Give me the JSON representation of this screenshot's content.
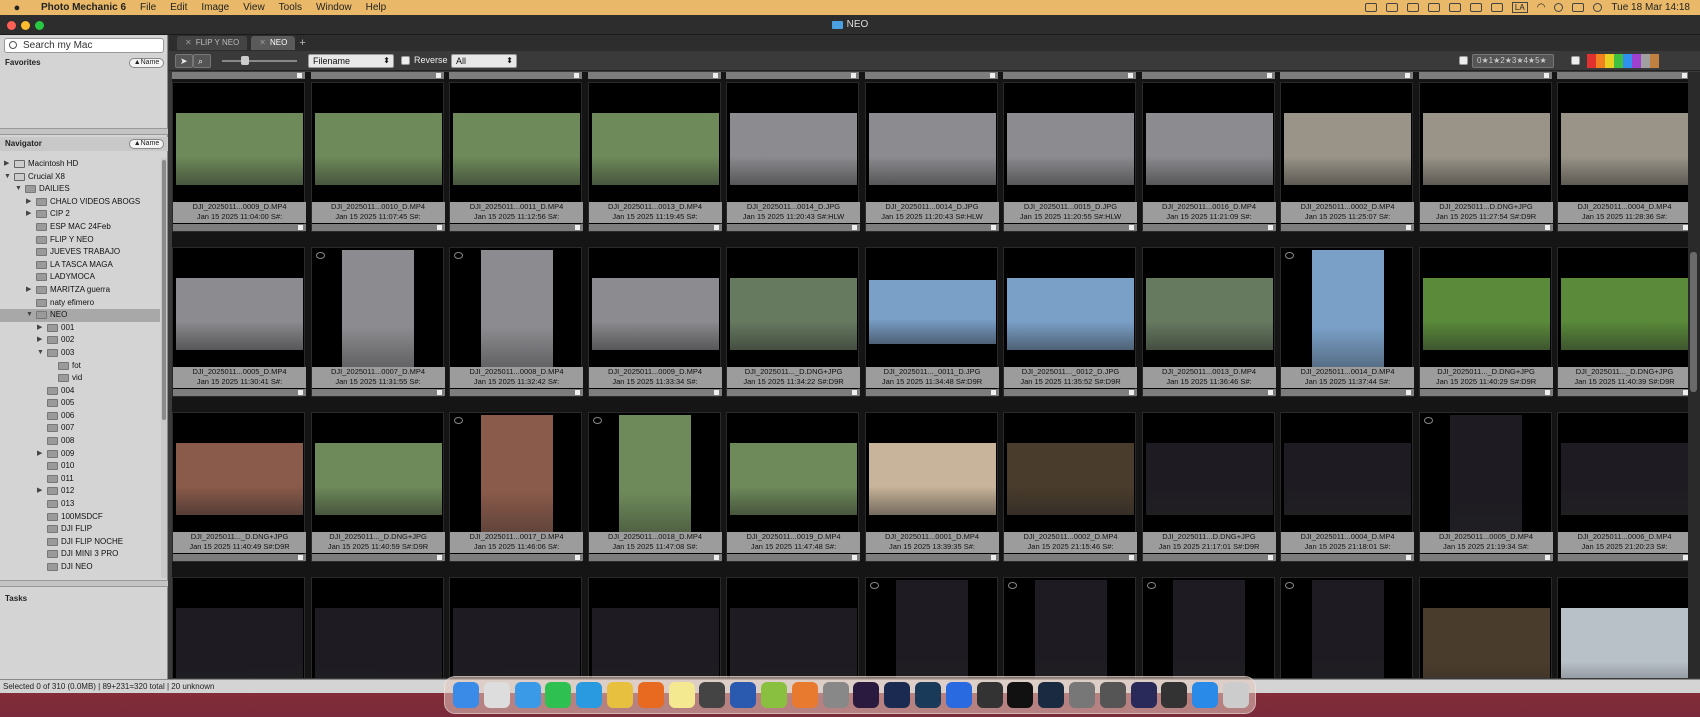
{
  "menubar": {
    "app_name": "Photo Mechanic 6",
    "items": [
      "File",
      "Edit",
      "Image",
      "View",
      "Tools",
      "Window",
      "Help"
    ],
    "clock": "Tue 18 Mar  14:18",
    "input_lang": "LA"
  },
  "window": {
    "title": "NEO"
  },
  "sidebar": {
    "search_placeholder": "Search my Mac",
    "favorites": {
      "label": "Favorites",
      "sort": "▲Name"
    },
    "navigator": {
      "label": "Navigator",
      "sort": "▲Name"
    },
    "tasks_label": "Tasks",
    "tree": [
      {
        "label": "Macintosh HD",
        "depth": 0,
        "arrow": "▶",
        "kind": "drive"
      },
      {
        "label": "Crucial X8",
        "depth": 0,
        "arrow": "▼",
        "kind": "drive"
      },
      {
        "label": "DAILIES",
        "depth": 1,
        "arrow": "▼"
      },
      {
        "label": "CHALO VIDEOS ABOGS",
        "depth": 2,
        "arrow": "▶"
      },
      {
        "label": "CIP 2",
        "depth": 2,
        "arrow": "▶"
      },
      {
        "label": "ESP MAC 24Feb",
        "depth": 2,
        "arrow": ""
      },
      {
        "label": "FLIP Y NEO",
        "depth": 2,
        "arrow": ""
      },
      {
        "label": "JUEVES TRABAJO",
        "depth": 2,
        "arrow": ""
      },
      {
        "label": "LA TASCA MAGA",
        "depth": 2,
        "arrow": ""
      },
      {
        "label": "LADYMOCA",
        "depth": 2,
        "arrow": ""
      },
      {
        "label": "MARITZA guerra",
        "depth": 2,
        "arrow": "▶"
      },
      {
        "label": "naty efimero",
        "depth": 2,
        "arrow": ""
      },
      {
        "label": "NEO",
        "depth": 2,
        "arrow": "▼",
        "selected": true
      },
      {
        "label": "001",
        "depth": 3,
        "arrow": "▶"
      },
      {
        "label": "002",
        "depth": 3,
        "arrow": "▶"
      },
      {
        "label": "003",
        "depth": 3,
        "arrow": "▼"
      },
      {
        "label": "fot",
        "depth": 4,
        "arrow": ""
      },
      {
        "label": "vid",
        "depth": 4,
        "arrow": ""
      },
      {
        "label": "004",
        "depth": 3,
        "arrow": ""
      },
      {
        "label": "005",
        "depth": 3,
        "arrow": ""
      },
      {
        "label": "006",
        "depth": 3,
        "arrow": ""
      },
      {
        "label": "007",
        "depth": 3,
        "arrow": ""
      },
      {
        "label": "008",
        "depth": 3,
        "arrow": ""
      },
      {
        "label": "009",
        "depth": 3,
        "arrow": "▶"
      },
      {
        "label": "010",
        "depth": 3,
        "arrow": ""
      },
      {
        "label": "011",
        "depth": 3,
        "arrow": ""
      },
      {
        "label": "012",
        "depth": 3,
        "arrow": "▶"
      },
      {
        "label": "013",
        "depth": 3,
        "arrow": ""
      },
      {
        "label": "100MSDCF",
        "depth": 3,
        "arrow": ""
      },
      {
        "label": "DJI FLIP",
        "depth": 3,
        "arrow": ""
      },
      {
        "label": "DJI FLIP NOCHE",
        "depth": 3,
        "arrow": ""
      },
      {
        "label": "DJI MINI 3 PRO",
        "depth": 3,
        "arrow": ""
      },
      {
        "label": "DJI NEO",
        "depth": 3,
        "arrow": ""
      }
    ]
  },
  "tabs": [
    {
      "label": "FLIP Y NEO",
      "active": false
    },
    {
      "label": "NEO",
      "active": true
    }
  ],
  "toolbar": {
    "sort_field": "Filename",
    "reverse_label": "Reverse",
    "filter": "All",
    "rating_filter": "0★1★2★3★4★5★",
    "add_tab": "+"
  },
  "grid": {
    "rows": [
      [
        {
          "name": "DJI_2025011...0009_D.MP4",
          "date": "Jan 15 2025 11:04:00 S#:",
          "tone": "park",
          "orient": "land"
        },
        {
          "name": "DJI_2025011...0010_D.MP4",
          "date": "Jan 15 2025 11:07:45 S#:",
          "tone": "park",
          "orient": "land"
        },
        {
          "name": "DJI_2025011...0011_D.MP4",
          "date": "Jan 15 2025 11:12:56 S#:",
          "tone": "park",
          "orient": "land"
        },
        {
          "name": "DJI_2025011...0013_D.MP4",
          "date": "Jan 15 2025 11:19:45 S#:",
          "tone": "park",
          "orient": "land"
        },
        {
          "name": "DJI_2025011...0014_D.JPG",
          "date": "Jan 15 2025 11:20:43 S#:HLW",
          "tone": "city",
          "orient": "land"
        },
        {
          "name": "DJI_2025011...0014_D.JPG",
          "date": "Jan 15 2025 11:20:43 S#:HLW",
          "tone": "city",
          "orient": "land"
        },
        {
          "name": "DJI_2025011...0015_D.JPG",
          "date": "Jan 15 2025 11:20:55 S#:HLW",
          "tone": "city",
          "orient": "land"
        },
        {
          "name": "DJI_2025011...0016_D.MP4",
          "date": "Jan 15 2025 11:21:09 S#:",
          "tone": "city",
          "orient": "land"
        },
        {
          "name": "DJI_2025011...0002_D.MP4",
          "date": "Jan 15 2025 11:25:07 S#:",
          "tone": "ground",
          "orient": "land"
        },
        {
          "name": "DJI_2025011...D.DNG+JPG",
          "date": "Jan 15 2025 11:27:54 S#:D9R",
          "tone": "ground",
          "orient": "land"
        },
        {
          "name": "DJI_2025011...0004_D.MP4",
          "date": "Jan 15 2025 11:28:36 S#:",
          "tone": "ground",
          "orient": "land"
        }
      ],
      [
        {
          "name": "DJI_2025011...0005_D.MP4",
          "date": "Jan 15 2025 11:30:41 S#:",
          "tone": "city",
          "orient": "land"
        },
        {
          "name": "DJI_2025011...0007_D.MP4",
          "date": "Jan 15 2025 11:31:55 S#:",
          "tone": "city",
          "orient": "port"
        },
        {
          "name": "DJI_2025011...0008_D.MP4",
          "date": "Jan 15 2025 11:32:42 S#:",
          "tone": "city",
          "orient": "port"
        },
        {
          "name": "DJI_2025011...0009_D.MP4",
          "date": "Jan 15 2025 11:33:34 S#:",
          "tone": "city",
          "orient": "land"
        },
        {
          "name": "DJI_2025011..._D.DNG+JPG",
          "date": "Jan 15 2025 11:34:22 S#:D9R",
          "tone": "hills",
          "orient": "land"
        },
        {
          "name": "DJI_2025011..._0011_D.JPG",
          "date": "Jan 15 2025 11:34:48 S#:D9R",
          "tone": "sky",
          "orient": "pano"
        },
        {
          "name": "DJI_2025011..._0012_D.JPG",
          "date": "Jan 15 2025 11:35:52 S#:D9R",
          "tone": "sky",
          "orient": "land"
        },
        {
          "name": "DJI_2025011...0013_D.MP4",
          "date": "Jan 15 2025 11:36:46 S#:",
          "tone": "hills",
          "orient": "land"
        },
        {
          "name": "DJI_2025011...0014_D.MP4",
          "date": "Jan 15 2025 11:37:44 S#:",
          "tone": "sky",
          "orient": "port"
        },
        {
          "name": "DJI_2025011..._D.DNG+JPG",
          "date": "Jan 15 2025 11:40:29 S#:D9R",
          "tone": "grass",
          "orient": "land"
        },
        {
          "name": "DJI_2025011..._D.DNG+JPG",
          "date": "Jan 15 2025 11:40:39 S#:D9R",
          "tone": "grass",
          "orient": "land"
        }
      ],
      [
        {
          "name": "DJI_2025011..._D.DNG+JPG",
          "date": "Jan 15 2025 11:40:49 S#:D9R",
          "tone": "brick",
          "orient": "land"
        },
        {
          "name": "DJI_2025011..._D.DNG+JPG",
          "date": "Jan 15 2025 11:40:59 S#:D9R",
          "tone": "park",
          "orient": "land"
        },
        {
          "name": "DJI_2025011...0017_D.MP4",
          "date": "Jan 15 2025 11:46:06 S#:",
          "tone": "brick",
          "orient": "port"
        },
        {
          "name": "DJI_2025011...0018_D.MP4",
          "date": "Jan 15 2025 11:47:08 S#:",
          "tone": "park",
          "orient": "port"
        },
        {
          "name": "DJI_2025011...0019_D.MP4",
          "date": "Jan 15 2025 11:47:48 S#:",
          "tone": "park",
          "orient": "land"
        },
        {
          "name": "DJI_2025011...0001_D.MP4",
          "date": "Jan 15 2025 13:39:35 S#:",
          "tone": "room",
          "orient": "land"
        },
        {
          "name": "DJI_2025011...0002_D.MP4",
          "date": "Jan 15 2025 21:15:46 S#:",
          "tone": "dusk",
          "orient": "land"
        },
        {
          "name": "DJI_2025011...D.DNG+JPG",
          "date": "Jan 15 2025 21:17:01 S#:D9R",
          "tone": "night",
          "orient": "land"
        },
        {
          "name": "DJI_2025011...0004_D.MP4",
          "date": "Jan 15 2025 21:18:01 S#:",
          "tone": "night",
          "orient": "land"
        },
        {
          "name": "DJI_2025011...0005_D.MP4",
          "date": "Jan 15 2025 21:19:34 S#:",
          "tone": "night",
          "orient": "port"
        },
        {
          "name": "DJI_2025011...0006_D.MP4",
          "date": "Jan 15 2025 21:20:23 S#:",
          "tone": "night",
          "orient": "land"
        }
      ],
      [
        {
          "name": "",
          "date": "",
          "tone": "night",
          "orient": "land"
        },
        {
          "name": "",
          "date": "",
          "tone": "night",
          "orient": "land"
        },
        {
          "name": "",
          "date": "",
          "tone": "night",
          "orient": "land"
        },
        {
          "name": "",
          "date": "",
          "tone": "night",
          "orient": "land"
        },
        {
          "name": "",
          "date": "",
          "tone": "night",
          "orient": "land"
        },
        {
          "name": "",
          "date": "",
          "tone": "night",
          "orient": "port"
        },
        {
          "name": "",
          "date": "",
          "tone": "night",
          "orient": "port"
        },
        {
          "name": "",
          "date": "",
          "tone": "night",
          "orient": "port"
        },
        {
          "name": "",
          "date": "",
          "tone": "night",
          "orient": "port"
        },
        {
          "name": "",
          "date": "",
          "tone": "dusk",
          "orient": "land"
        },
        {
          "name": "",
          "date": "",
          "tone": "building",
          "orient": "land"
        }
      ]
    ]
  },
  "status": "Selected 0 of 310 (0.0MB) | 89+231=320 total | 20 unknown",
  "colors": {
    "tones": {
      "park": "#6e8a5a",
      "city": "#8c8c90",
      "ground": "#9a9488",
      "hills": "#667a60",
      "sky": "#7aa0c8",
      "grass": "#5a8a3a",
      "brick": "#8a5a4a",
      "room": "#c8b49a",
      "dusk": "#4a3c2c",
      "night": "#1e1c22",
      "building": "#b8c0c8"
    },
    "labels": [
      "#e03030",
      "#f08020",
      "#e8d020",
      "#40c040",
      "#3090f0",
      "#a040d0",
      "#a0a0a0",
      "#c08040"
    ]
  },
  "dock": [
    "finder-icon",
    "launchpad-icon",
    "safari-icon",
    "whatsapp-icon",
    "telegram-icon",
    "chrome-icon",
    "firefox-icon",
    "notes-icon",
    "font-book-icon",
    "word-icon",
    "android-icon",
    "fox-icon",
    "settings-wheel-icon",
    "premiere-icon",
    "photoshop-icon",
    "lightroom-icon",
    "ctb-icon",
    "davinci-icon",
    "capcut-icon",
    "steam-icon",
    "system-settings-icon",
    "screenshot-icon",
    "obs-icon",
    "obs-alt-icon",
    "app-store-icon",
    "trash-icon"
  ]
}
